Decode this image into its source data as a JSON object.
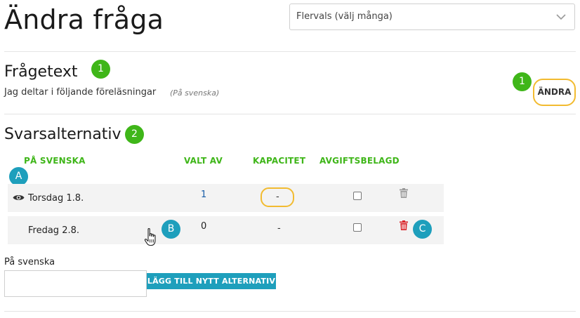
{
  "header": {
    "title": "Ändra fråga",
    "type_select_value": "Flervals (välj många)"
  },
  "question_section": {
    "title": "Frågetext",
    "badge": "1",
    "text": "Jag deltar i följande föreläsningar",
    "lang_note": "(På svenska)",
    "edit_badge": "1",
    "edit_label": "ÄNDRA"
  },
  "answers_section": {
    "title": "Svarsalternativ",
    "badge": "2",
    "columns": [
      "PÅ SVENSKA",
      "VALT AV",
      "KAPACITET",
      "AVGIFTSBELAGD"
    ],
    "rows": [
      {
        "label": "Torsdag 1.8.",
        "chosen_by": "1",
        "capacity": "-",
        "paid": false
      },
      {
        "label": "Fredag 2.8.",
        "chosen_by": "0",
        "capacity": "-",
        "paid": false
      }
    ],
    "markers": {
      "a": "A",
      "b": "B",
      "c": "C"
    }
  },
  "new_option": {
    "label": "På svenska",
    "input_value": "",
    "add_label": "LÄGG TILL NYTT ALTERNATIV"
  },
  "colors": {
    "green": "#3fb619",
    "teal": "#1e9fbc",
    "highlight": "#f2bb30",
    "link_blue": "#1a5ea8",
    "delete_red": "#d9262b",
    "muted_gray": "#9a9a9a"
  },
  "icons": [
    "chevron-down-icon",
    "eye-icon",
    "trash-icon",
    "hand-pointer-icon"
  ]
}
